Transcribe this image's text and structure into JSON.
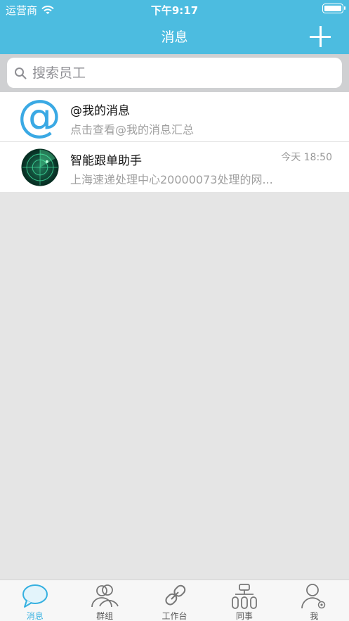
{
  "status_bar": {
    "carrier": "运营商",
    "time": "下午9:17"
  },
  "nav": {
    "title": "消息"
  },
  "search": {
    "placeholder": "搜索员工"
  },
  "messages": [
    {
      "title": "@我的消息",
      "subtitle": "点击查看@我的消息汇总",
      "time": ""
    },
    {
      "title": "智能跟单助手",
      "subtitle": "上海速递处理中心20000073处理的网...",
      "time": "今天 18:50"
    }
  ],
  "tabs": [
    {
      "label": "消息",
      "icon": "chat-bubble-icon",
      "active": true
    },
    {
      "label": "群组",
      "icon": "group-icon",
      "active": false
    },
    {
      "label": "工作台",
      "icon": "link-icon",
      "active": false
    },
    {
      "label": "同事",
      "icon": "org-chart-icon",
      "active": false
    },
    {
      "label": "我",
      "icon": "user-settings-icon",
      "active": false
    }
  ],
  "colors": {
    "accent": "#4cbce0",
    "active_tab": "#35b0e0",
    "background": "#e5e5e5"
  }
}
